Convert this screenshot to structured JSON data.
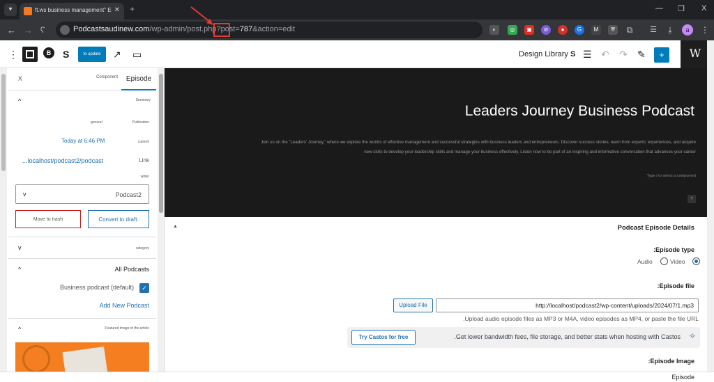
{
  "browser": {
    "tab_title": "ft.ws business management\" Edit Episode",
    "url_host": "Podcastsaudinew.com",
    "url_path": "/wp-admin/post.php?post=",
    "url_highlight": "787",
    "url_rest": "&action=edit",
    "profile_initial": "a"
  },
  "toolbar": {
    "update_label": "to update",
    "design_library": "Design Library",
    "wp_logo": "W"
  },
  "sidebar": {
    "tab_component": "Component",
    "tab_episode": "Episode",
    "summary": "Summary",
    "general": "general",
    "publication": "Publication",
    "publish_time": "Today at 6:46 PM",
    "custom": "custom",
    "link_label": "Link",
    "link_value": "...localhost/podcast2/podcast",
    "writer": "writer",
    "template_value": "Podcast2",
    "move_to_trash": "Move to trash",
    "convert_to_draft": "Convert to draft.",
    "collapsed_section": "category",
    "all_podcasts": "All Podcasts",
    "business_podcast": "Business podcast (default)",
    "add_new_podcast": "Add New Podcast",
    "featured_image": "Featured image of the article"
  },
  "hero": {
    "title": "Leaders Journey Business Podcast",
    "text_line1": "Join us on the \"Leaders' Journey,\" where we explore the worlds of effective management and successful strategies with business leaders and entrepreneurs. Discover success stories, learn from experts' experiences, and acquire",
    "text_line2": "new skills to develop your leadership skills and manage your business effectively. Listen now to be part of an inspiring and informative conversation that advances your career",
    "hint": "Type / to select a component"
  },
  "meta": {
    "title": "Podcast Episode Details",
    "episode_type_label": ":Episode type",
    "audio": "Audio",
    "video": "Video",
    "episode_file_label": ":Episode file",
    "upload_file": "Upload File",
    "file_url": "http://localhost/podcast2/wp-content/uploads/2024/07/1.mp3",
    "help_text": ".Upload audio episode files as MP3 or M4A, video episodes as MP4, or paste the file URL",
    "castos_button": "Try Castos for free",
    "castos_text": ".Get lower bandwidth fees, file storage, and better stats when hosting with Castos",
    "episode_image_label": ":Episode Image"
  },
  "status_bar": {
    "label": "Episode"
  }
}
